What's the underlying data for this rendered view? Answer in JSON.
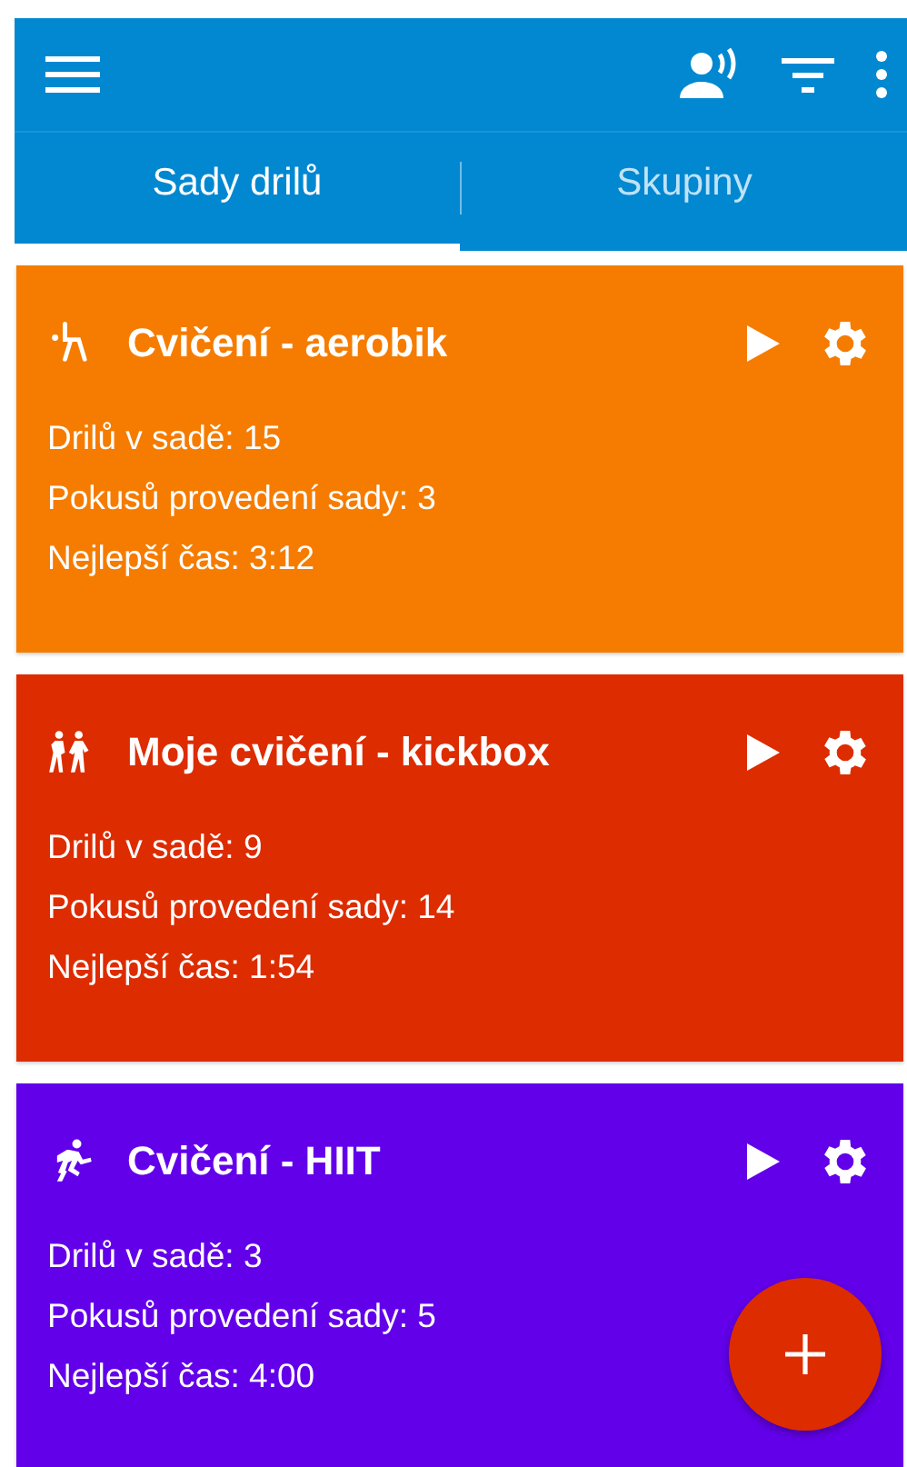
{
  "tabs": [
    {
      "label": "Sady drilů",
      "selected": true
    },
    {
      "label": "Skupiny",
      "selected": false
    }
  ],
  "cards": [
    {
      "kind": "aerobic",
      "title": "Cvičení - aerobik",
      "color": "#f57c00",
      "stats": [
        "Drilů v sadě: 15",
        "Pokusů provedení sady: 3",
        "Nejlepší čas: 3:12"
      ]
    },
    {
      "kind": "walkers",
      "title": "Moje cvičení - kickbox",
      "color": "#dd2c00",
      "stats": [
        "Drilů v sadě: 9",
        "Pokusů provedení sady: 14",
        "Nejlepší čas: 1:54"
      ]
    },
    {
      "kind": "runner",
      "title": "Cvičení - HIIT",
      "color": "#6200ea",
      "stats": [
        "Drilů v sadě: 3",
        "Pokusů provedení sady: 5",
        "Nejlepší čas: 4:00"
      ]
    }
  ]
}
